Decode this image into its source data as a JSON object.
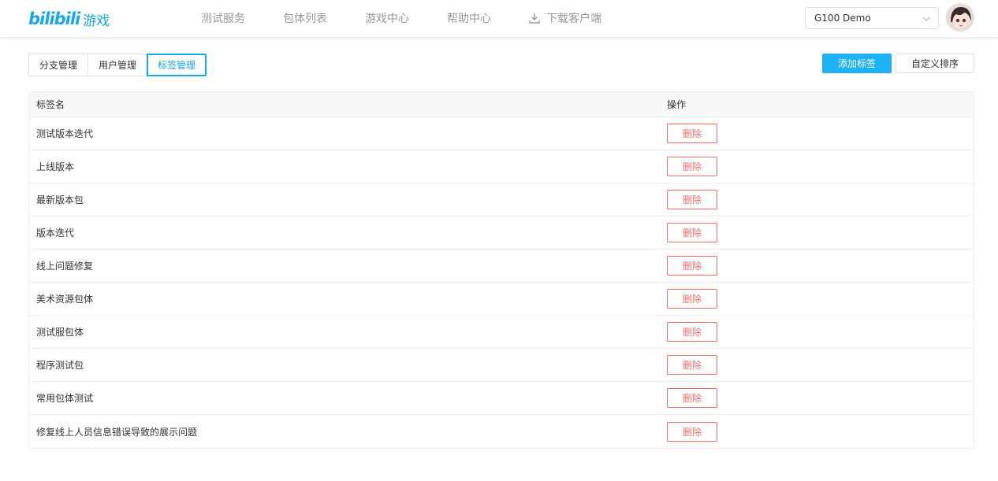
{
  "brand": {
    "logo_text": "bilibili",
    "sub_text": "游戏",
    "accent": "#1aa6e8"
  },
  "nav": {
    "items": [
      {
        "label": "测试服务"
      },
      {
        "label": "包体列表"
      },
      {
        "label": "游戏中心"
      },
      {
        "label": "帮助中心"
      },
      {
        "label": "下载客户端",
        "icon": "download-icon"
      }
    ]
  },
  "project_select": {
    "value": "G100 Demo",
    "icon": "chevron-down-icon"
  },
  "user": {
    "avatar_icon": "user-avatar"
  },
  "tabs": [
    {
      "label": "分支管理",
      "active": false
    },
    {
      "label": "用户管理",
      "active": false
    },
    {
      "label": "标签管理",
      "active": true
    }
  ],
  "actions": {
    "add_label": "添加标签",
    "custom_sort": "自定义排序"
  },
  "table": {
    "headers": {
      "name": "标签名",
      "op": "操作"
    },
    "delete_label": "删除",
    "rows": [
      {
        "name": "测试版本迭代"
      },
      {
        "name": "上线版本"
      },
      {
        "name": "最新版本包"
      },
      {
        "name": "版本迭代"
      },
      {
        "name": "线上问题修复"
      },
      {
        "name": "美术资源包体"
      },
      {
        "name": "测试服包体"
      },
      {
        "name": "程序测试包"
      },
      {
        "name": "常用包体测试"
      },
      {
        "name": "修复线上人员信息错误导致的展示问题"
      }
    ]
  },
  "colors": {
    "primary": "#1db2f5",
    "danger": "#f56c6c",
    "border": "#ebeef5"
  }
}
